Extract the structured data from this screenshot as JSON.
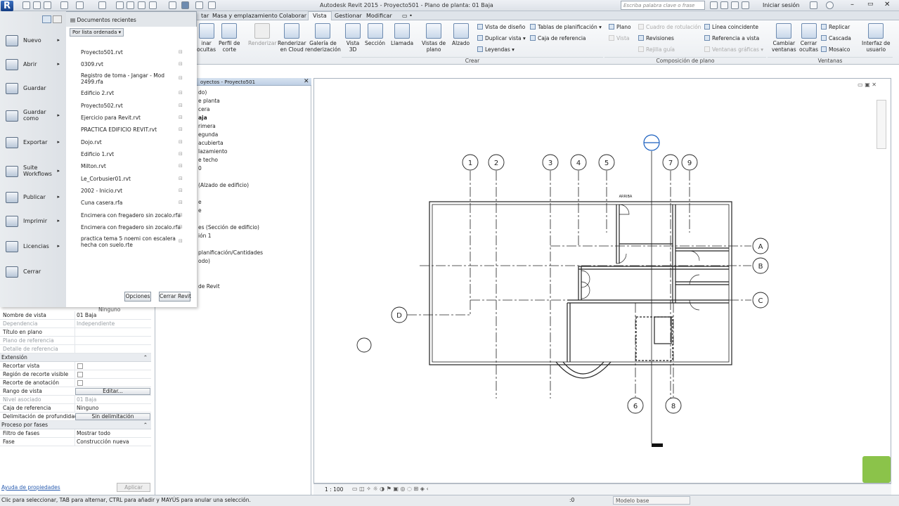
{
  "window": {
    "title": "Autodesk Revit 2015 -  Proyecto501 - Plano de planta: 01 Baja",
    "search_placeholder": "Escriba palabra clave o frase",
    "signin": "Iniciar sesión"
  },
  "ribbon": {
    "tabs": [
      "tar",
      "Masa y emplazamiento",
      "Colaborar",
      "Vista",
      "Gestionar",
      "Modificar",
      "▭ •"
    ],
    "active_tab": "Vista",
    "buttons": {
      "ocultas": "inar\nocultas",
      "perfil": "Perfil de\ncorte",
      "renderizar": "Renderizar",
      "renderizar_cloud": "Renderizar\nen Cloud",
      "galeria": "Galería de\nrenderización",
      "vista3d": "Vista\n3D",
      "seccion": "Sección",
      "llamada": "Llamada",
      "vistas_plano": "Vistas de\nplano",
      "alzado": "Alzado",
      "cambiar_ventanas": "Cambiar\nventanas",
      "cerrar_ocultas": "Cerrar\nocultas",
      "interfaz": "Interfaz de\nusuario",
      "plano": "Plano",
      "vista": "Vista"
    },
    "small": {
      "vista_diseno": "Vista de diseño",
      "duplicar_vista": "Duplicar vista",
      "leyendas": "Leyendas",
      "tablas": "Tablas de planificación",
      "caja_ref": "Caja de referencia",
      "cuadro_rot": "Cuadro de rotulación",
      "revisiones": "Revisiones",
      "rejilla_guia": "Rejilla guía",
      "linea_coincidente": "Línea coincidente",
      "referencia_vista": "Referencia a vista",
      "ventanas_graficas": "Ventanas gráficas",
      "replicar": "Replicar",
      "cascada": "Cascada",
      "mosaico": "Mosaico"
    },
    "panels": [
      "Crear",
      "Composición de plano",
      "Ventanas"
    ]
  },
  "app_menu": {
    "header": "Documentos recientes",
    "sort": "Por lista ordenada",
    "items": [
      "Nuevo",
      "Abrir",
      "Guardar",
      "Guardar\ncomo",
      "Exportar",
      "Suite\nWorkflows",
      "Publicar",
      "Imprimir",
      "Licencias",
      "Cerrar"
    ],
    "recent": [
      "Proyecto501.rvt",
      "0309.rvt",
      "Registro de toma - Jangar - Mod\n2499.rfa",
      "Edificio 2.rvt",
      "Proyecto502.rvt",
      "Ejercicio para Revit.rvt",
      "PRACTICA EDIFICIO REVIT.rvt",
      "Dojo.rvt",
      "Edificio 1.rvt",
      "Milton.rvt",
      "Le_Corbusier01.rvt",
      "2002 - Inicio.rvt",
      "Cuna casera.rfa",
      "Encimera con fregadero sin zocalo.rfa",
      "Encimera con fregadero sin zocalo.rfa",
      "practica tema 5 noemi con escalera\nhecha con suelo.rte"
    ],
    "options_btn": "Opciones",
    "exit_btn": "Cerrar Revit"
  },
  "browser": {
    "title": "oyectos - Proyecto501",
    "items": [
      "do)",
      "e planta",
      "cera",
      "aja",
      "rimera",
      "egunda",
      "acubierta",
      "lazamiento",
      "e techo",
      "0",
      "(Alzado de edificio)",
      "e",
      "e",
      "es (Sección de edificio)",
      "ión 1",
      "planificación/Cantidades",
      "odo)",
      "de Revit"
    ]
  },
  "properties": {
    "top_value": "Ninguno",
    "rows1": [
      {
        "k": "Nombre de vista",
        "v": "01 Baja",
        "grey": false
      },
      {
        "k": "Dependencia",
        "v": "Independiente",
        "grey": true
      },
      {
        "k": "Título en plano",
        "v": "",
        "grey": false
      },
      {
        "k": "Plano de referencia",
        "v": "",
        "grey": true
      },
      {
        "k": "Detalle de referencia",
        "v": "",
        "grey": true
      }
    ],
    "group_extension": "Extensión",
    "recortar_vista": "Recortar vista",
    "region_recorte": "Región de recorte visible",
    "recorte_anotacion": "Recorte de anotación",
    "rango_vista": "Rango de vista",
    "editar": "Editar...",
    "nivel_asociado": "Nivel asociado",
    "nivel_asociado_v": "01 Baja",
    "caja_ref": "Caja de referencia",
    "caja_ref_v": "Ninguno",
    "delim": "Delimitación de profundidad",
    "delim_v": "Sin delimitación",
    "group_fases": "Proceso por fases",
    "filtro": "Filtro de fases",
    "filtro_v": "Mostrar todo",
    "fase": "Fase",
    "fase_v": "Construcción nueva",
    "help": "Ayuda de propiedades",
    "apply": "Aplicar"
  },
  "drawing": {
    "grid_top": [
      "1",
      "2",
      "3",
      "4",
      "5",
      "7",
      "9"
    ],
    "grid_right": [
      "A",
      "B",
      "C"
    ],
    "grid_left": [
      "D"
    ],
    "grid_bottom": [
      "6",
      "8"
    ],
    "arriba": "ARRIBA"
  },
  "viewbar": {
    "scale": "1 : 100"
  },
  "status": {
    "text": "Clic para seleccionar, TAB para alternar, CTRL para añadir y MAYÚS para anular una selección.",
    "counter": ":0",
    "model": "Modelo base"
  }
}
